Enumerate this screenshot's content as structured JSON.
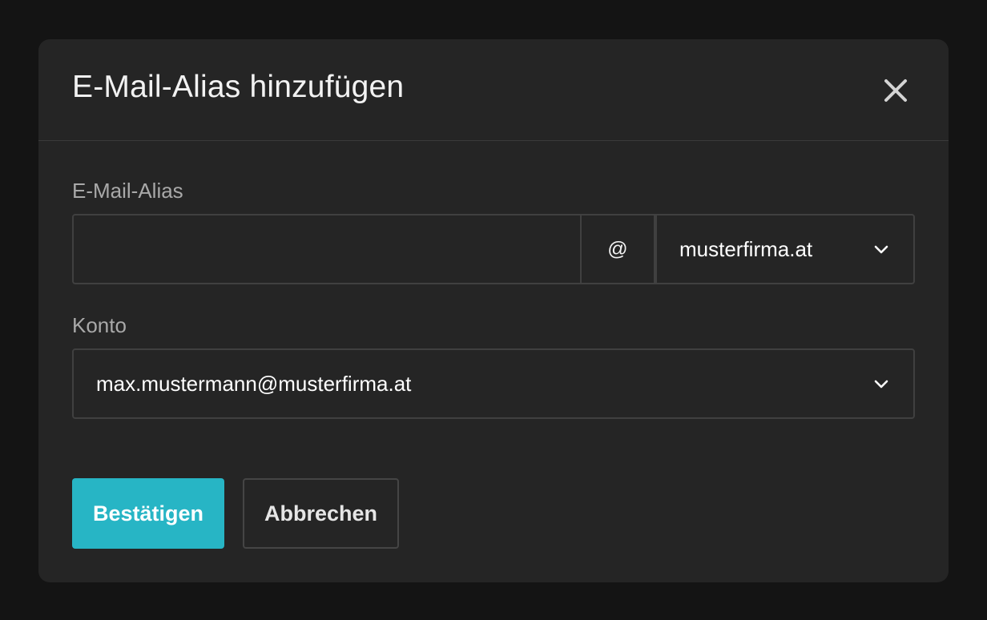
{
  "dialog": {
    "title": "E-Mail-Alias hinzufügen",
    "close_icon": "close-icon"
  },
  "alias_field": {
    "label": "E-Mail-Alias",
    "value": "",
    "placeholder": "",
    "at_sign": "@",
    "domain_selected": "musterfirma.at",
    "domain_icon": "chevron-down-icon"
  },
  "konto_field": {
    "label": "Konto",
    "selected": "max.mustermann@musterfirma.at",
    "icon": "chevron-down-icon"
  },
  "actions": {
    "confirm_label": "Bestätigen",
    "cancel_label": "Abbrechen"
  },
  "colors": {
    "backdrop": "#141414",
    "dialog_bg": "#252525",
    "border": "#404040",
    "accent": "#27b5c5",
    "title_text": "#f2f2f2",
    "label_text": "#a9a9a9"
  }
}
